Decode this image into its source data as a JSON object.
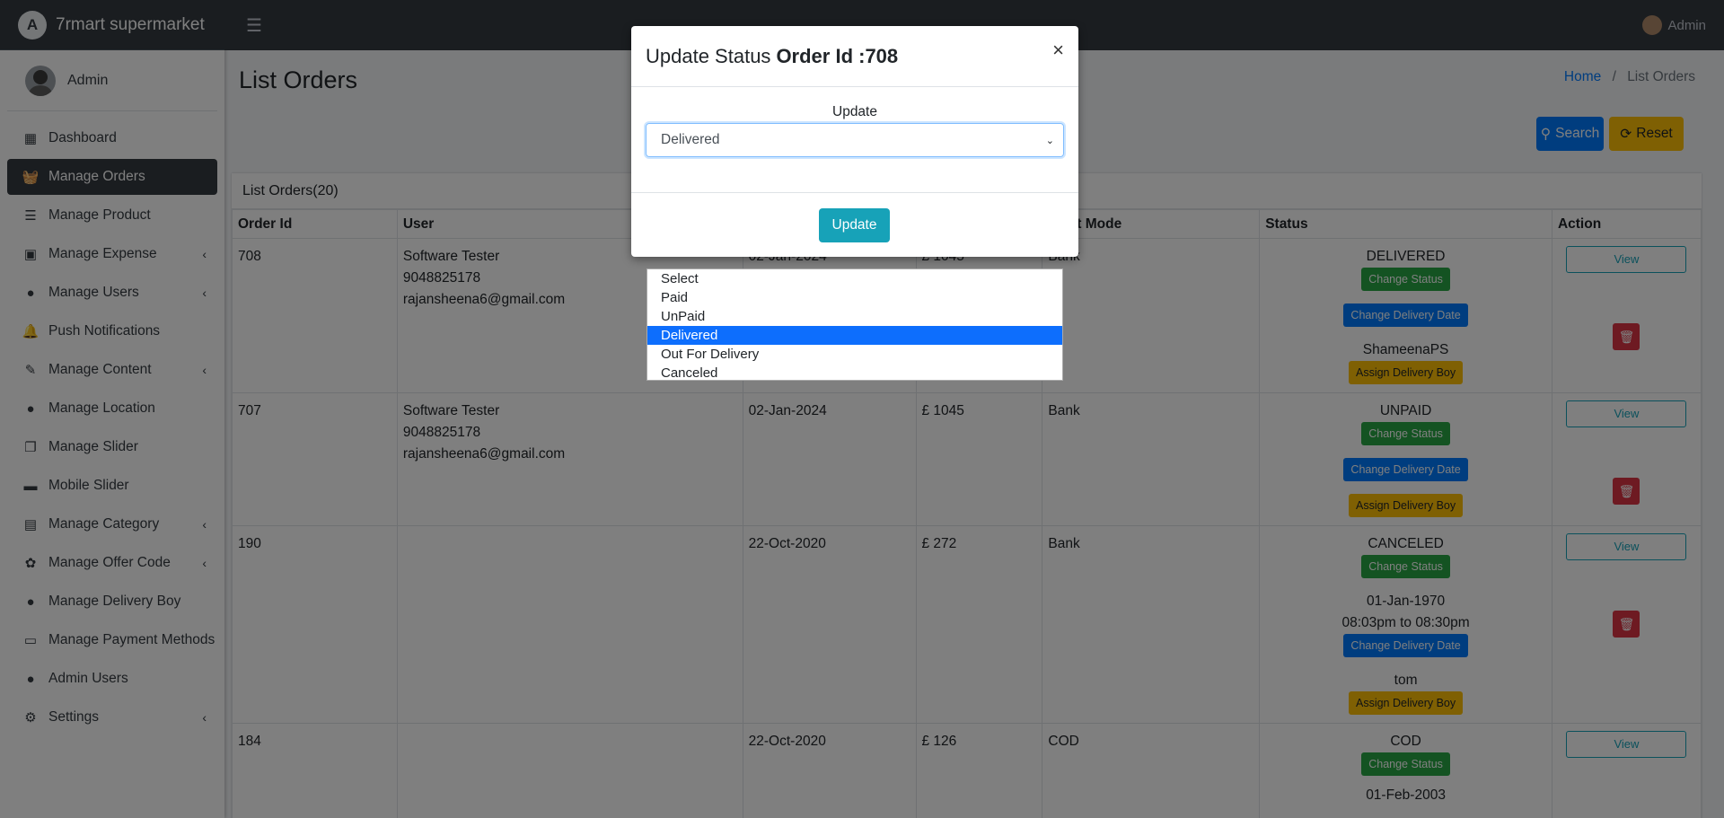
{
  "brand": {
    "name": "7rmart supermarket"
  },
  "navbar": {
    "user": "Admin"
  },
  "sidebar": {
    "user": "Admin",
    "items": [
      {
        "label": "Dashboard",
        "icon": "dashboard-icon"
      },
      {
        "label": "Manage Orders",
        "icon": "basket-icon"
      },
      {
        "label": "Manage Product",
        "icon": "list-icon"
      },
      {
        "label": "Manage Expense",
        "icon": "money-icon"
      },
      {
        "label": "Manage Users",
        "icon": "user-icon"
      },
      {
        "label": "Push Notifications",
        "icon": "bell-icon"
      },
      {
        "label": "Manage Content",
        "icon": "edit-icon"
      },
      {
        "label": "Manage Location",
        "icon": "map-marker-icon"
      },
      {
        "label": "Manage Slider",
        "icon": "slides-icon"
      },
      {
        "label": "Mobile Slider",
        "icon": "minus-icon"
      },
      {
        "label": "Manage Category",
        "icon": "list-alt-icon"
      },
      {
        "label": "Manage Offer Code",
        "icon": "tags-icon"
      },
      {
        "label": "Manage Delivery Boy",
        "icon": "user-plus-icon"
      },
      {
        "label": "Manage Payment Methods",
        "icon": "credit-card-icon"
      },
      {
        "label": "Admin Users",
        "icon": "users-icon"
      },
      {
        "label": "Settings",
        "icon": "gear-icon"
      }
    ]
  },
  "page": {
    "title": "List Orders",
    "breadcrumb_home": "Home",
    "breadcrumb_sep": "/",
    "breadcrumb_current": "List Orders",
    "search_label": "Search",
    "reset_label": "Reset",
    "card_title": "List Orders(20)"
  },
  "table": {
    "headers": [
      "Order Id",
      "User",
      "",
      "",
      "ment Mode",
      "Status",
      "Action"
    ],
    "rows": [
      {
        "id": "708",
        "user_name": "Software Tester",
        "user_phone": "9048825178",
        "user_email": "rajansheena6@gmail.com",
        "date": "02-Jan-2024",
        "amount": "£ 1045",
        "mode": "Bank",
        "status": "DELIVERED",
        "change_status": "Change Status",
        "change_date": "Change Delivery Date",
        "delivery_boy": "ShameenaPS",
        "assign": "Assign Delivery Boy",
        "view": "View"
      },
      {
        "id": "707",
        "user_name": "Software Tester",
        "user_phone": "9048825178",
        "user_email": "rajansheena6@gmail.com",
        "date": "02-Jan-2024",
        "amount": "£ 1045",
        "mode": "Bank",
        "status": "UNPAID",
        "change_status": "Change Status",
        "change_date": "Change Delivery Date",
        "assign": "Assign Delivery Boy",
        "view": "View"
      },
      {
        "id": "190",
        "date": "22-Oct-2020",
        "amount": "£ 272",
        "mode": "Bank",
        "status": "CANCELED",
        "change_status": "Change Status",
        "delivery_date": "01-Jan-1970",
        "delivery_time": "08:03pm to 08:30pm",
        "change_date": "Change Delivery Date",
        "delivery_boy": "tom",
        "assign": "Assign Delivery Boy",
        "view": "View"
      },
      {
        "id": "184",
        "date": "22-Oct-2020",
        "amount": "£ 126",
        "mode": "COD",
        "status": "COD",
        "change_status": "Change Status",
        "delivery_date": "01-Feb-2003",
        "view": "View"
      }
    ]
  },
  "modal": {
    "title_prefix": "Update Status",
    "title_bold": "Order Id :708",
    "close": "×",
    "label": "Update",
    "selected": "Delivered",
    "button": "Update",
    "options": [
      "Select",
      "Paid",
      "UnPaid",
      "Delivered",
      "Out For Delivery",
      "Canceled"
    ]
  }
}
